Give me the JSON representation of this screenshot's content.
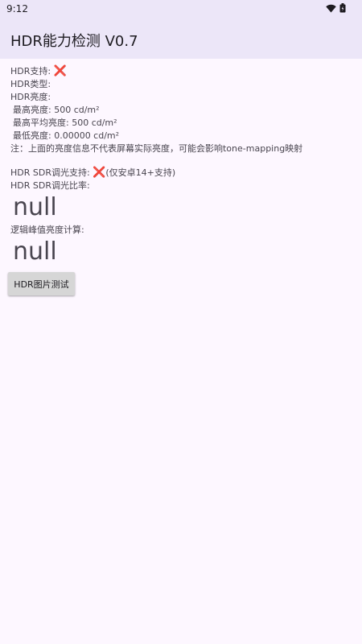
{
  "status_bar": {
    "time": "9:12",
    "icons": [
      "wifi-icon",
      "battery-icon"
    ]
  },
  "app_bar": {
    "title": "HDR能力检测 V0.7"
  },
  "info": {
    "hdr_support_label": "HDR支持: ",
    "hdr_support_value": "❌",
    "hdr_type_label": "HDR类型:",
    "hdr_brightness_label": "HDR亮度:",
    "max_brightness": "最高亮度: 500 cd/m²",
    "max_avg_brightness": "最高平均亮度: 500 cd/m²",
    "min_brightness": "最低亮度: 0.00000 cd/m²",
    "note": "注：上面的亮度信息不代表屏幕实际亮度，可能会影响tone-mapping映射",
    "sdr_dimming_label": "HDR SDR调光支持: ",
    "sdr_dimming_value": "❌",
    "sdr_dimming_note": "(仅安卓14+支持)",
    "sdr_ratio_label": "HDR SDR调光比率:",
    "sdr_ratio_value": "null",
    "peak_calc_label": "逻辑峰值亮度计算:",
    "peak_calc_value": "null"
  },
  "buttons": {
    "hdr_image_test": "HDR图片测试"
  },
  "colors": {
    "app_bar_bg": "#ece6f8",
    "page_bg": "#fdf7ff",
    "cross_red": "#e0302a",
    "button_bg": "#d6d6d6"
  }
}
